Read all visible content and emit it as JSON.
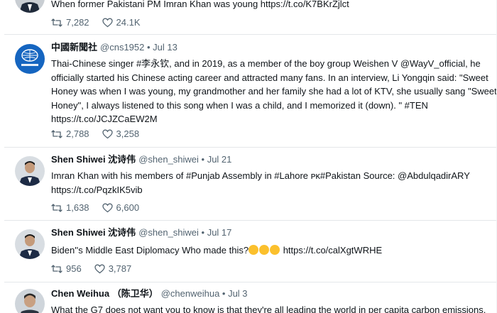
{
  "tweets": [
    {
      "text_lines": [
        "When former Pakistani PM Imran Khan was young https://t.co/K7BKrZjlct"
      ],
      "retweets": "7,282",
      "likes": "24.1K"
    },
    {
      "name": "中國新聞社",
      "meta": "@cns1952 • Jul 13",
      "text_lines": [
        "Thai-Chinese singer #李永钦, and in 2019, as a member of the boy group Weishen V @WayV_official, he",
        "officially started his Chinese acting career and attracted many fans. In an interview, Li Yongqin said: \"Sweet",
        "Honey was when I was young, my grandmother and her family she had a lot of KTV, she usually sang \"Sweet",
        "Honey\", I always listened to this song when I was a child, and I memorized it (down). \" #TEN",
        "https://t.co/JCJZCaEW2M"
      ],
      "retweets": "2,788",
      "likes": "3,258"
    },
    {
      "name": "Shen Shiwei 沈诗伟",
      "meta": "@shen_shiwei • Jul 21",
      "text_lines": [
        "Imran Khan with his members of #Punjab Assembly in #Lahore ᴘᴋ#Pakistan Source: @AbdulqadirARY",
        "https://t.co/PqzkIK5vib"
      ],
      "retweets": "1,638",
      "likes": "6,600"
    },
    {
      "name": "Shen Shiwei 沈诗伟",
      "meta": "@shen_shiwei • Jul 17",
      "text_before": "Biden''s Middle East Diplomacy Who made this?",
      "text_after": " https://t.co/calXgtWRHE",
      "retweets": "956",
      "likes": "3,787"
    },
    {
      "name": "Chen Weihua （陈卫华）",
      "meta": "@chenweihua • Jul 3",
      "text_lines": [
        "What the G7 does not want you to know is that they're all leading the world in per capita carbon emissions."
      ]
    }
  ]
}
